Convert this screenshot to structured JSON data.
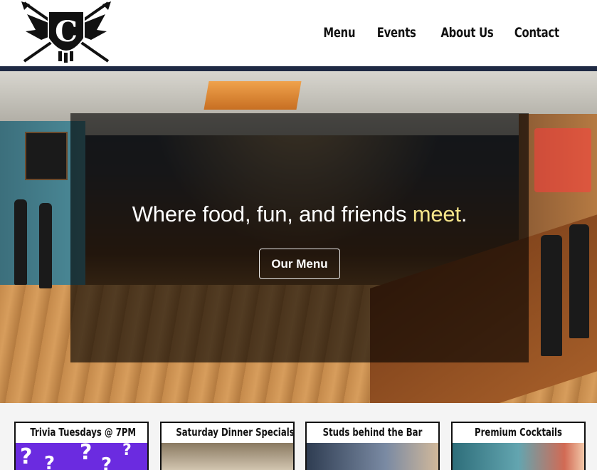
{
  "header": {
    "logo_letter": "C",
    "nav": [
      {
        "label": "Menu"
      },
      {
        "label": "Events"
      },
      {
        "label": "About Us"
      },
      {
        "label": "Contact"
      }
    ]
  },
  "hero": {
    "headline_main": "Where food, fun, and friends ",
    "headline_accent": "meet",
    "headline_end": ".",
    "button_label": "Our Menu"
  },
  "cards": [
    {
      "title": "Trivia Tuesdays @ 7PM"
    },
    {
      "title": "Saturday Dinner Specials"
    },
    {
      "title": "Studs behind the Bar"
    },
    {
      "title": "Premium Cocktails"
    }
  ],
  "colors": {
    "nav_text": "#111111",
    "divider": "#1f2a44",
    "accent_yellow": "#f6e58a",
    "trivia_purple": "#6b2be0"
  }
}
